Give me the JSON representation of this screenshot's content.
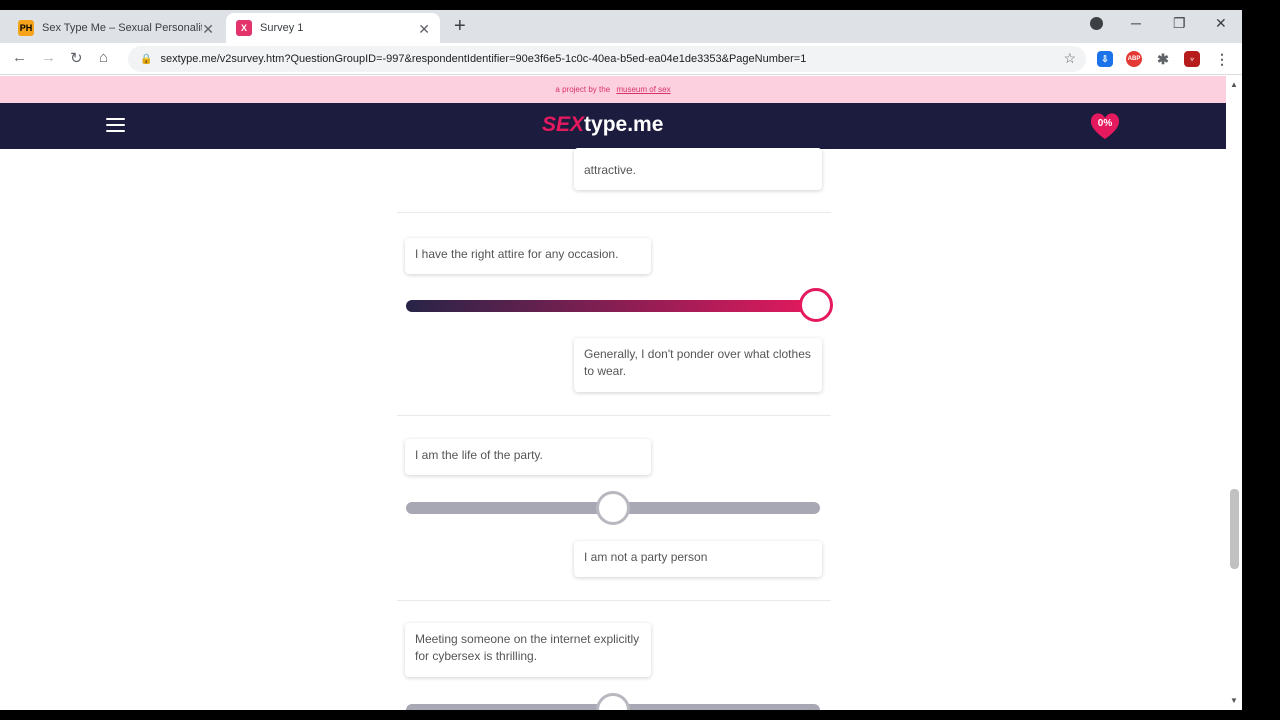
{
  "browser": {
    "tabs": [
      {
        "label": "Sex Type Me – Sexual Personality",
        "favicon": "PH"
      },
      {
        "label": "Survey 1",
        "favicon": "X"
      }
    ],
    "url": "sextype.me/v2survey.htm?QuestionGroupID=-997&respondentIdentifier=90e3f6e5-1c0c-40ea-b5ed-ea04e1de3353&PageNumber=1",
    "ext_abp": "ABP"
  },
  "site": {
    "project_prefix": "a project by the",
    "project_link": "museum of sex",
    "logo_sex": "SEX",
    "logo_rest": "type.me",
    "progress": "0%"
  },
  "questions": [
    {
      "left_text": "",
      "right_text": "attractive.",
      "value": null
    },
    {
      "left_text": "I have the right attire for any occasion.",
      "right_text": "Generally, I don't ponder over what clothes to wear.",
      "value": 1.0
    },
    {
      "left_text": "I am the life of the party.",
      "right_text": "I am not a party person",
      "value": 0.5
    },
    {
      "left_text": "Meeting someone on the internet explicitly for cybersex is thrilling.",
      "right_text": "",
      "value": 0.5
    }
  ],
  "colors": {
    "accent": "#e5195e",
    "nav_bg": "#1c1c3f",
    "project_bar": "#fdd0df"
  }
}
